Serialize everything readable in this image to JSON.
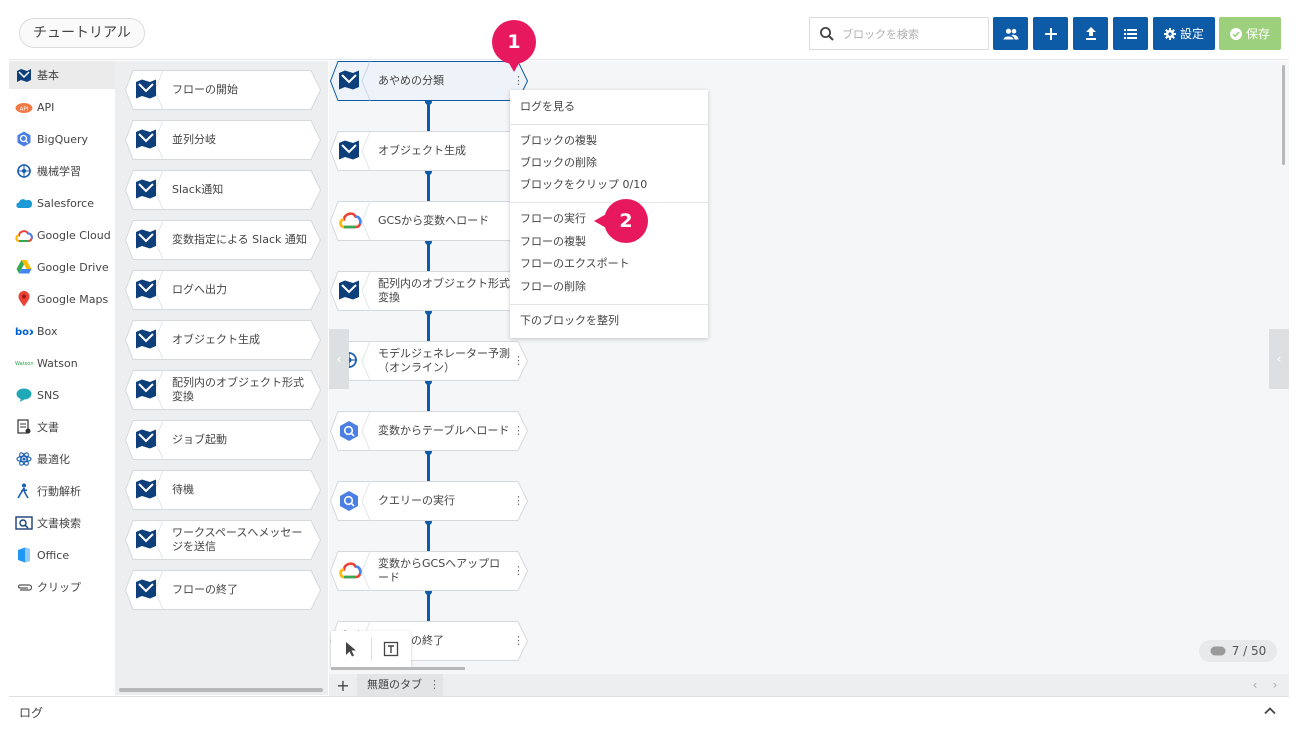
{
  "header": {
    "flow_title": "チュートリアル",
    "search_placeholder": "ブロックを検索",
    "settings_label": "設定",
    "save_label": "保存"
  },
  "categories": [
    {
      "label": "基本",
      "icon": "basic-icon",
      "active": true
    },
    {
      "label": "API",
      "icon": "api-icon"
    },
    {
      "label": "BigQuery",
      "icon": "bigquery-icon"
    },
    {
      "label": "機械学習",
      "icon": "machine-learning-icon"
    },
    {
      "label": "Salesforce",
      "icon": "salesforce-icon"
    },
    {
      "label": "Google Cloud",
      "icon": "google-cloud-icon"
    },
    {
      "label": "Google Drive",
      "icon": "google-drive-icon"
    },
    {
      "label": "Google Maps",
      "icon": "google-maps-icon"
    },
    {
      "label": "Box",
      "icon": "box-icon"
    },
    {
      "label": "Watson",
      "icon": "watson-icon"
    },
    {
      "label": "SNS",
      "icon": "sns-icon"
    },
    {
      "label": "文書",
      "icon": "document-icon"
    },
    {
      "label": "最適化",
      "icon": "optimization-icon"
    },
    {
      "label": "行動解析",
      "icon": "behavior-analysis-icon"
    },
    {
      "label": "文書検索",
      "icon": "document-search-icon"
    },
    {
      "label": "Office",
      "icon": "office-icon"
    },
    {
      "label": "クリップ",
      "icon": "clip-icon"
    }
  ],
  "palette": [
    {
      "label": "フローの開始"
    },
    {
      "label": "並列分岐"
    },
    {
      "label": "Slack通知"
    },
    {
      "label": "変数指定による Slack 通知"
    },
    {
      "label": "ログへ出力"
    },
    {
      "label": "オブジェクト生成"
    },
    {
      "label": "配列内のオブジェクト形式変換"
    },
    {
      "label": "ジョブ起動"
    },
    {
      "label": "待機"
    },
    {
      "label": "ワークスペースへメッセージを送信"
    },
    {
      "label": "フローの終了"
    }
  ],
  "flow": [
    {
      "label": "あやめの分類",
      "icon": "magellan-icon"
    },
    {
      "label": "オブジェクト生成",
      "icon": "magellan-icon"
    },
    {
      "label": "GCSから変数へロード",
      "icon": "google-cloud-icon"
    },
    {
      "label": "配列内のオブジェクト形式変換",
      "icon": "magellan-icon"
    },
    {
      "label": "モデルジェネレーター予測（オンライン）",
      "icon": "machine-learning-icon"
    },
    {
      "label": "変数からテーブルへロード",
      "icon": "bigquery-icon"
    },
    {
      "label": "クエリーの実行",
      "icon": "bigquery-icon"
    },
    {
      "label": "変数からGCSへアップロード",
      "icon": "google-cloud-icon"
    },
    {
      "label": "フローの終了",
      "icon": "magellan-icon"
    }
  ],
  "context_menu": {
    "view_log": "ログを見る",
    "duplicate_block": "ブロックの複製",
    "delete_block": "ブロックの削除",
    "clip_block": "ブロックをクリップ 0/10",
    "run_flow": "フローの実行",
    "duplicate_flow": "フローの複製",
    "export_flow": "フローのエクスポート",
    "delete_flow": "フローの削除",
    "align_below": "下のブロックを整列"
  },
  "badges": [
    "1",
    "2"
  ],
  "counter": "7 / 50",
  "tabs": [
    {
      "label": "無題のタブ"
    }
  ],
  "log": {
    "label": "ログ"
  },
  "colors": {
    "primary": "#0d5aa7",
    "save": "#9cd07c",
    "badge": "#e8185f"
  }
}
